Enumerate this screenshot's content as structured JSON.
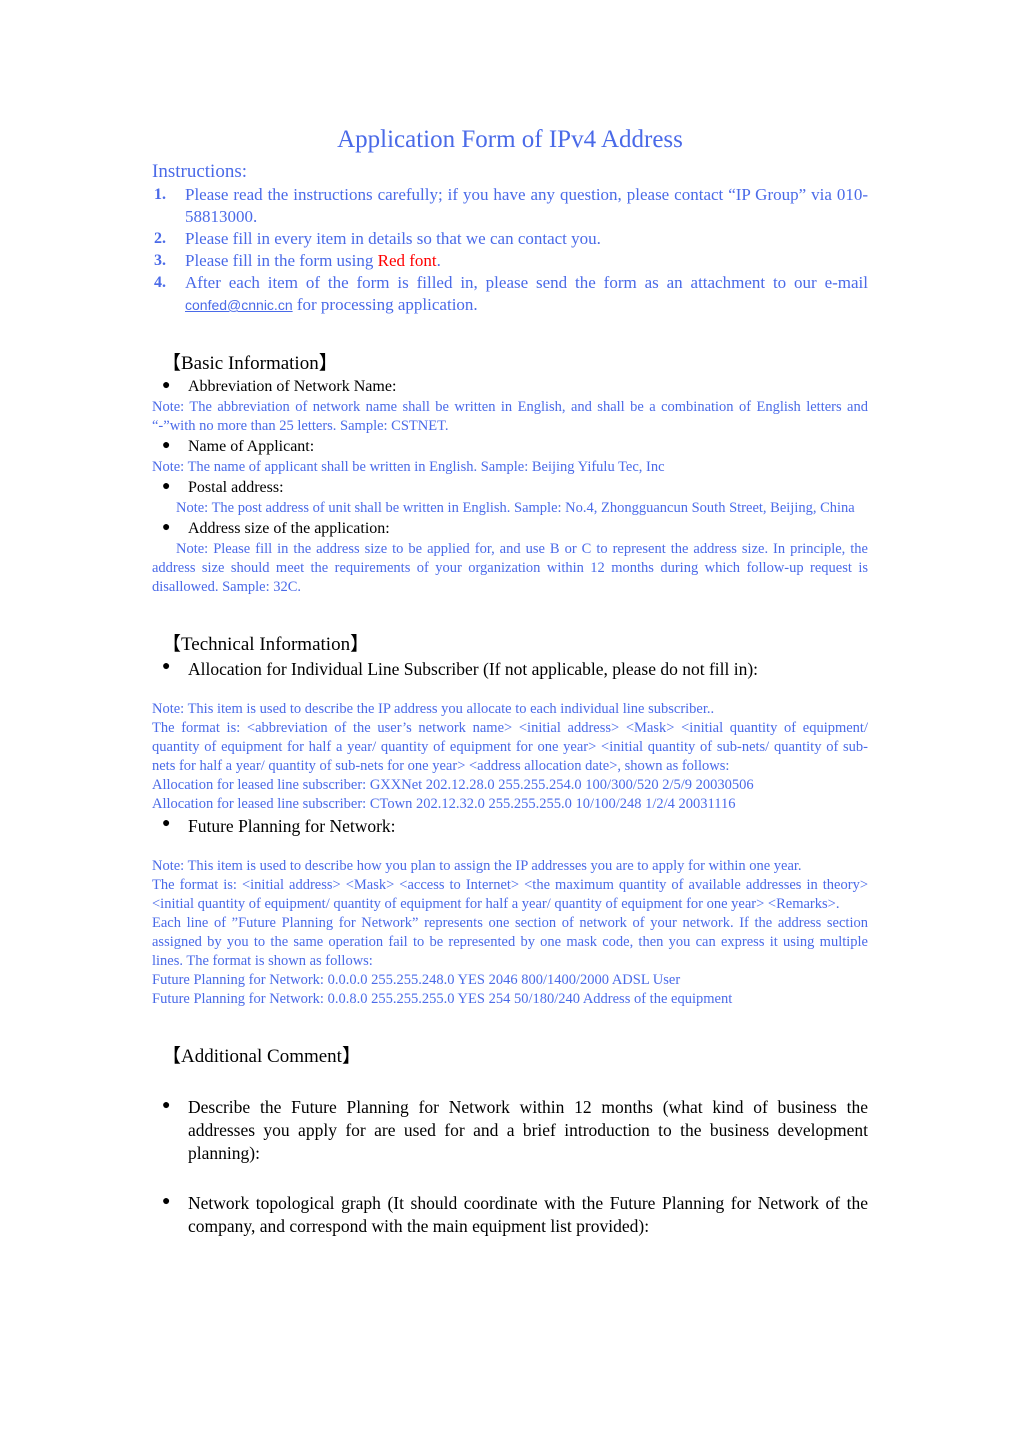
{
  "document": {
    "title": "Application Form of IPv4 Address",
    "instructions_label": "Instructions:",
    "instructions": [
      {
        "number": "1.",
        "text": "Please read the instructions carefully; if you have any question, please contact “IP Group” via 010-58813000."
      },
      {
        "number": "2.",
        "text": "Please fill in every item in details so that we can contact you."
      },
      {
        "number": "3.",
        "text_before": "Please fill in the form using ",
        "highlight": "Red font",
        "text_after": "."
      },
      {
        "number": "4.",
        "text_before": "After each item of the form is filled in, please send the form as an attachment to our e-mail ",
        "link": "confed@cnnic.cn",
        "text_after": " for processing application."
      }
    ],
    "sections": [
      {
        "heading": "【Basic Information】",
        "items": [
          {
            "bullet": "Abbreviation of Network Name:",
            "notes": [
              "Note: The abbreviation of network name shall be written in English, and shall be a combination of English letters and “-”with no more than 25 letters. Sample: CSTNET."
            ]
          },
          {
            "bullet": "Name of Applicant:",
            "notes": [
              "Note: The name of applicant shall be written in English. Sample: Beijing Yifulu Tec, Inc"
            ]
          },
          {
            "bullet": "Postal address:",
            "notes": [
              "Note: The post address of unit shall be written in English. Sample: No.4, Zhongguancun South Street, Beijing, China"
            ]
          },
          {
            "bullet": "Address size of the application:",
            "notes": [
              "Note: Please fill in the address size to be applied for, and use B or C to represent the address size. In principle, the address size should meet the requirements of your organization within 12 months during which follow-up request is disallowed. Sample: 32C."
            ]
          }
        ]
      },
      {
        "heading": "【Technical Information】",
        "items": [
          {
            "bullet": "Allocation for Individual Line Subscriber (If not applicable, please do not fill in):",
            "notes": [
              "Note: This item is used to describe the IP address you allocate to each individual line subscriber..",
              "The format is: <abbreviation of the user’s network name> <initial address> <Mask> <initial quantity of equipment/ quantity of equipment for half a year/ quantity of equipment for one year> <initial quantity of sub-nets/ quantity of sub-nets for half a year/ quantity of sub-nets for one year> <address allocation date>, shown as follows:",
              "Allocation for leased line subscriber: GXXNet 202.12.28.0 255.255.254.0 100/300/520 2/5/9 20030506",
              "Allocation for leased line subscriber: CTown 202.12.32.0 255.255.255.0 10/100/248 1/2/4 20031116"
            ]
          },
          {
            "bullet": "Future Planning for Network:",
            "notes": [
              "Note: This item is used to describe how you plan to assign the IP addresses you are to apply for within one year.",
              "The format is: <initial address> <Mask> <access to Internet> <the maximum quantity of available addresses in theory> <initial quantity of equipment/ quantity of equipment for half a year/ quantity of equipment for one year> <Remarks>.",
              "Each line of ”Future Planning for Network” represents one section of network of your network. If the address section assigned by you to the same operation fail to be represented by one mask code, then you can express it using multiple lines. The format is shown as follows:",
              "Future Planning for Network: 0.0.0.0 255.255.248.0 YES 2046 800/1400/2000 ADSL User",
              "Future Planning for Network: 0.0.8.0 255.255.255.0 YES 254 50/180/240 Address of the equipment"
            ]
          }
        ]
      },
      {
        "heading": "【Additional Comment】",
        "items": [
          {
            "bullet": "Describe the Future Planning for Network within 12 months (what kind of business the addresses you apply for are used for and a brief introduction to the business development planning):",
            "notes": []
          },
          {
            "bullet": "Network topological graph (It should coordinate with the Future Planning for Network of the company, and correspond with the main equipment list provided):",
            "notes": []
          }
        ]
      }
    ],
    "colors": {
      "title_blue": "#4a6ae8",
      "body_blue": "#4a6ae8",
      "highlight_red": "#ff0000",
      "heading_black": "#000000"
    },
    "bullet_glyph": "●"
  }
}
